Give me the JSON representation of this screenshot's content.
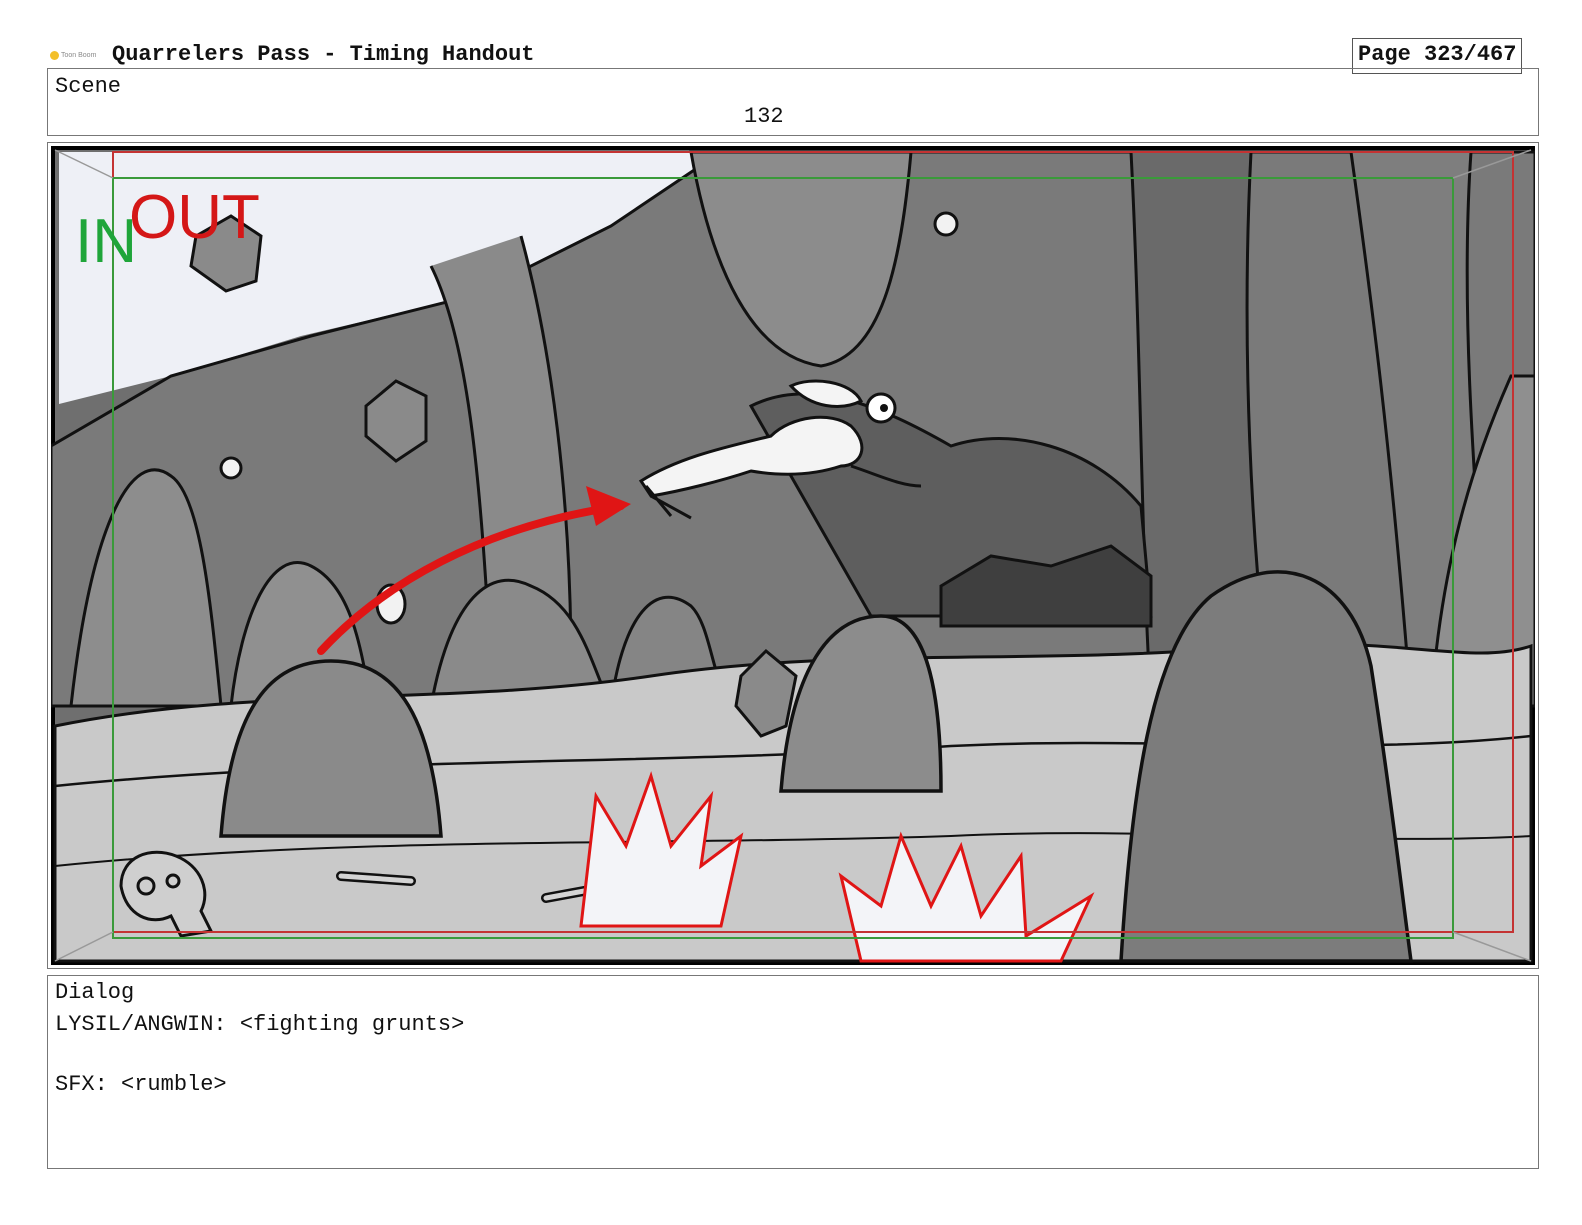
{
  "header": {
    "logo_text": "Toon Boom",
    "title": "Quarrelers Pass - Timing Handout",
    "page": "Page 323/467"
  },
  "scene": {
    "label": "Scene",
    "number": "132"
  },
  "panel": {
    "in_label": "IN",
    "out_label": "OUT"
  },
  "dialog": {
    "label": "Dialog",
    "lines": [
      "LYSIL/ANGWIN: <fighting grunts>",
      "SFX: <rumble>"
    ]
  },
  "colors": {
    "in_text": "#1fa53a",
    "out_text": "#d41717",
    "motion_arrow": "#e01515",
    "safe_frame_green": "#3a9a3a",
    "action_frame_red": "#c43333"
  }
}
